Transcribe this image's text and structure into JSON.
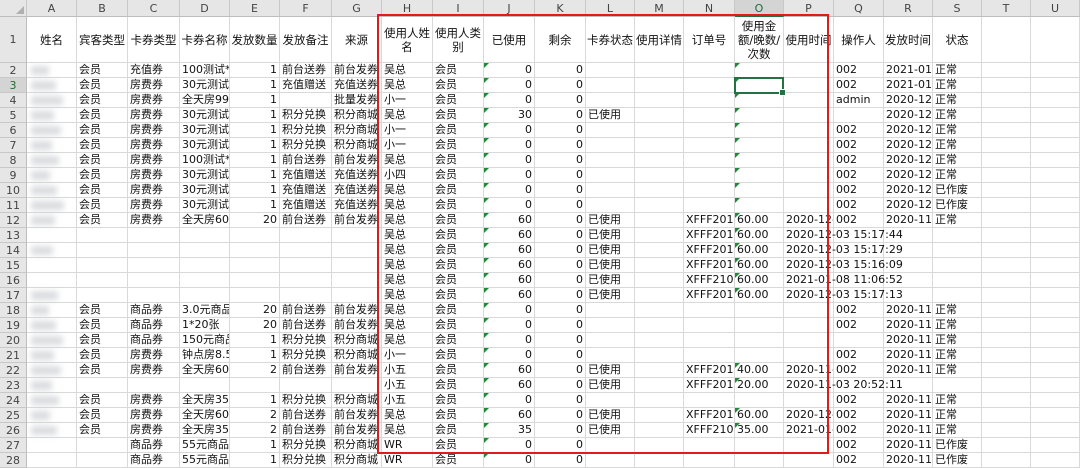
{
  "columns": [
    "A",
    "B",
    "C",
    "D",
    "E",
    "F",
    "G",
    "H",
    "I",
    "J",
    "K",
    "L",
    "M",
    "N",
    "O",
    "P",
    "Q",
    "R",
    "S",
    "T",
    "U"
  ],
  "selected_column": "O",
  "header_row": [
    "姓名",
    "宾客类型",
    "卡券类型",
    "卡券名称",
    "发放数量",
    "发放备注",
    "来源",
    "使用人姓名",
    "使用人类别",
    "已使用",
    "剩余",
    "卡券状态",
    "使用详情",
    "订单号",
    "使用金额/晚数/次数",
    "使用时间",
    "操作人",
    "发放时间",
    "状态"
  ],
  "rows": [
    {
      "num": "2",
      "cells": [
        "",
        "会员",
        "充值券",
        "100测试*1",
        "1",
        "前台送券",
        "前台发券",
        "吴总",
        "会员",
        "0",
        "0",
        "",
        "",
        "",
        "",
        "",
        "002",
        "2021-01-1",
        "正常"
      ]
    },
    {
      "num": "3",
      "cells": [
        "",
        "会员",
        "房费券",
        "30元测试1",
        "1",
        "充值赠送",
        "充值送券",
        "吴总",
        "会员",
        "0",
        "0",
        "",
        "",
        "",
        "",
        "",
        "002",
        "2021-01-0",
        "正常"
      ]
    },
    {
      "num": "4",
      "cells": [
        "",
        "会员",
        "房费券",
        "全天房999",
        "1",
        "",
        "批量发券",
        "小一",
        "会员",
        "0",
        "0",
        "",
        "",
        "",
        "",
        "",
        "admin",
        "2020-12-2",
        "正常"
      ]
    },
    {
      "num": "5",
      "cells": [
        "",
        "会员",
        "房费券",
        "30元测试1",
        "1",
        "积分兑换",
        "积分商城",
        "吴总",
        "会员",
        "30",
        "0",
        "已使用",
        "",
        "",
        "",
        "",
        "",
        "2020-12-1",
        "正常"
      ]
    },
    {
      "num": "6",
      "cells": [
        "",
        "会员",
        "房费券",
        "30元测试1",
        "1",
        "积分兑换",
        "积分商城",
        "小一",
        "会员",
        "0",
        "0",
        "",
        "",
        "",
        "",
        "",
        "002",
        "2020-12-1",
        "正常"
      ]
    },
    {
      "num": "7",
      "cells": [
        "",
        "会员",
        "房费券",
        "30元测试1",
        "1",
        "积分兑换",
        "积分商城",
        "小一",
        "会员",
        "0",
        "0",
        "",
        "",
        "",
        "",
        "",
        "002",
        "2020-12-1",
        "正常"
      ]
    },
    {
      "num": "8",
      "cells": [
        "",
        "会员",
        "房费券",
        "100测试*1",
        "1",
        "前台送券",
        "前台发券",
        "吴总",
        "会员",
        "0",
        "0",
        "",
        "",
        "",
        "",
        "",
        "002",
        "2020-12-0",
        "正常"
      ]
    },
    {
      "num": "9",
      "cells": [
        "",
        "会员",
        "房费券",
        "30元测试1",
        "1",
        "充值赠送",
        "充值送券",
        "小四",
        "会员",
        "0",
        "0",
        "",
        "",
        "",
        "",
        "",
        "002",
        "2020-12-0",
        "正常"
      ]
    },
    {
      "num": "10",
      "cells": [
        "",
        "会员",
        "房费券",
        "30元测试1",
        "1",
        "充值赠送",
        "充值送券",
        "吴总",
        "会员",
        "0",
        "0",
        "",
        "",
        "",
        "",
        "",
        "002",
        "2020-12-0",
        "已作废"
      ]
    },
    {
      "num": "11",
      "cells": [
        "",
        "会员",
        "房费券",
        "30元测试1",
        "1",
        "充值赠送",
        "充值送券",
        "吴总",
        "会员",
        "0",
        "0",
        "",
        "",
        "",
        "",
        "",
        "002",
        "2020-12-0",
        "已作废"
      ]
    },
    {
      "num": "12",
      "cells": [
        "",
        "会员",
        "房费券",
        "全天房60",
        "20",
        "前台送券",
        "前台发券",
        "吴总",
        "会员",
        "60",
        "0",
        "已使用",
        "",
        "XFFF2012",
        "60.00",
        "2020-12-0",
        "002",
        "2020-11-1",
        "正常"
      ]
    },
    {
      "num": "13",
      "cells": [
        "",
        "",
        "",
        "",
        "",
        "",
        "",
        "吴总",
        "会员",
        "60",
        "0",
        "已使用",
        "",
        "XFFF2012",
        "60.00",
        "2020-12-03 15:17:44",
        "",
        "",
        ""
      ]
    },
    {
      "num": "14",
      "cells": [
        "",
        "",
        "",
        "",
        "",
        "",
        "",
        "吴总",
        "会员",
        "60",
        "0",
        "已使用",
        "",
        "XFFF2012",
        "60.00",
        "2020-12-03 15:17:29",
        "",
        "",
        ""
      ]
    },
    {
      "num": "15",
      "cells": [
        "",
        "",
        "",
        "",
        "",
        "",
        "",
        "吴总",
        "会员",
        "60",
        "0",
        "已使用",
        "",
        "XFFF2012",
        "60.00",
        "2020-12-03 15:16:09",
        "",
        "",
        ""
      ]
    },
    {
      "num": "16",
      "cells": [
        "",
        "",
        "",
        "",
        "",
        "",
        "",
        "吴总",
        "会员",
        "60",
        "0",
        "已使用",
        "",
        "XFFF2101",
        "60.00",
        "2021-01-08 11:06:52",
        "",
        "",
        ""
      ]
    },
    {
      "num": "17",
      "cells": [
        "",
        "",
        "",
        "",
        "",
        "",
        "",
        "吴总",
        "会员",
        "60",
        "0",
        "已使用",
        "",
        "XFFF2012",
        "60.00",
        "2020-12-03 15:17:13",
        "",
        "",
        ""
      ]
    },
    {
      "num": "18",
      "cells": [
        "",
        "会员",
        "商品券",
        "3.0元商品",
        "20",
        "前台送券",
        "前台发券",
        "吴总",
        "会员",
        "0",
        "0",
        "",
        "",
        "",
        "",
        "",
        "002",
        "2020-11-1",
        "正常"
      ]
    },
    {
      "num": "19",
      "cells": [
        "",
        "会员",
        "商品券",
        "1*20张",
        "20",
        "前台送券",
        "前台发券",
        "吴总",
        "会员",
        "0",
        "0",
        "",
        "",
        "",
        "",
        "",
        "002",
        "2020-11-1",
        "正常"
      ]
    },
    {
      "num": "20",
      "cells": [
        "",
        "会员",
        "商品券",
        "150元商品",
        "1",
        "积分兑换",
        "积分商城",
        "吴总",
        "会员",
        "0",
        "0",
        "",
        "",
        "",
        "",
        "",
        "",
        "2020-11-0",
        "正常"
      ]
    },
    {
      "num": "21",
      "cells": [
        "",
        "会员",
        "房费券",
        "钟点房8.5",
        "1",
        "积分兑换",
        "积分商城",
        "小一",
        "会员",
        "0",
        "0",
        "",
        "",
        "",
        "",
        "",
        "002",
        "2020-11-0",
        "正常"
      ]
    },
    {
      "num": "22",
      "cells": [
        "",
        "会员",
        "房费券",
        "全天房60",
        "2",
        "前台送券",
        "前台发券",
        "小五",
        "会员",
        "60",
        "0",
        "已使用",
        "",
        "XFFF2011",
        "40.00",
        "2020-11-0",
        "002",
        "2020-11-0",
        "正常"
      ]
    },
    {
      "num": "23",
      "cells": [
        "",
        "",
        "",
        "",
        "",
        "",
        "",
        "小五",
        "会员",
        "60",
        "0",
        "已使用",
        "",
        "XFFF2011",
        "20.00",
        "2020-11-03 20:52:11",
        "",
        "",
        ""
      ]
    },
    {
      "num": "24",
      "cells": [
        "",
        "会员",
        "房费券",
        "全天房35",
        "1",
        "积分兑换",
        "积分商城",
        "小五",
        "会员",
        "0",
        "0",
        "",
        "",
        "",
        "",
        "",
        "002",
        "2020-11-0",
        "正常"
      ]
    },
    {
      "num": "25",
      "cells": [
        "",
        "会员",
        "房费券",
        "全天房60",
        "2",
        "前台送券",
        "前台发券",
        "吴总",
        "会员",
        "60",
        "0",
        "已使用",
        "",
        "XFFF2012",
        "60.00",
        "2020-12-0",
        "002",
        "2020-11-0",
        "正常"
      ]
    },
    {
      "num": "26",
      "cells": [
        "",
        "会员",
        "房费券",
        "全天房35",
        "2",
        "前台送券",
        "前台发券",
        "吴总",
        "会员",
        "35",
        "0",
        "已使用",
        "",
        "XFFF2101",
        "35.00",
        "2021-01-0",
        "002",
        "2020-11-0",
        "正常"
      ]
    },
    {
      "num": "27",
      "cells": [
        "",
        "",
        "商品券",
        "55元商品",
        "1",
        "积分兑换",
        "积分商城",
        "WR",
        "会员",
        "0",
        "0",
        "",
        "",
        "",
        "",
        "",
        "002",
        "2020-11-0",
        "已作废"
      ]
    },
    {
      "num": "28",
      "cells": [
        "",
        "",
        "商品券",
        "55元商品",
        "1",
        "积分兑换",
        "积分商城",
        "WR",
        "会员",
        "0",
        "0",
        "",
        "",
        "",
        "",
        "",
        "002",
        "2020-11-0",
        "已作废"
      ]
    }
  ],
  "colors": {
    "highlight_box": "#e01b1b",
    "active_cell": "#217346",
    "header_bg": "#e6e6e6",
    "grid": "#d9d9d9",
    "error_indicator": "#1f8a3a"
  }
}
